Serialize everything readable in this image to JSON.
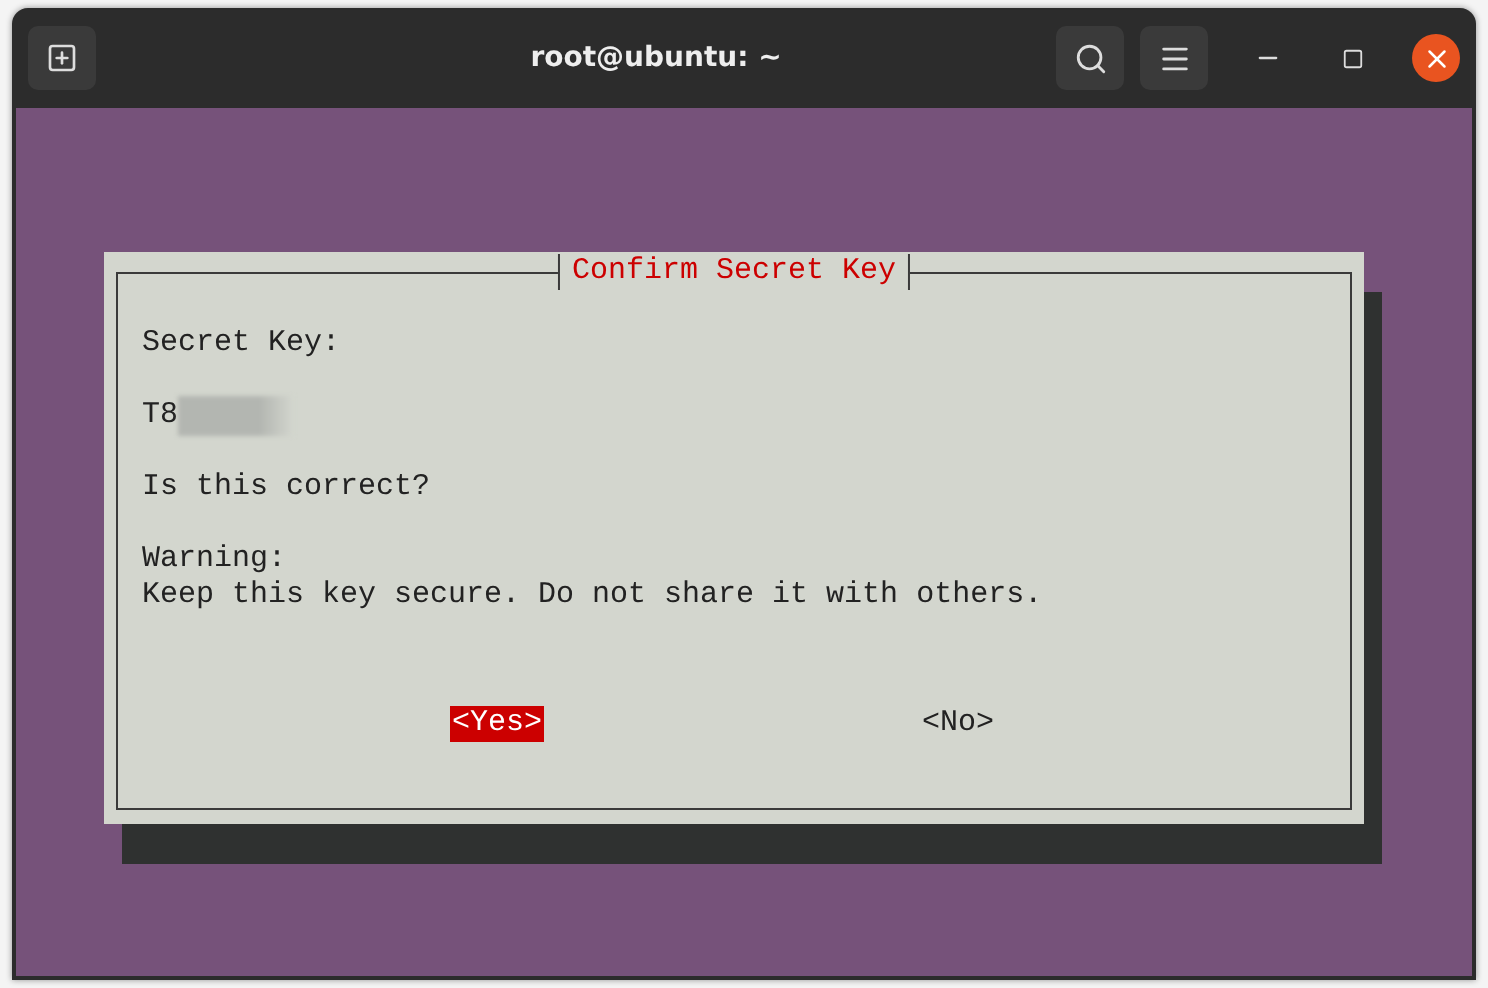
{
  "window": {
    "title": "root@ubuntu: ~"
  },
  "dialog": {
    "title": "Confirm Secret Key",
    "label": "Secret Key:",
    "secret_key": {
      "value": "T8",
      "redacted": true
    },
    "question": "Is this correct?",
    "warning_heading": "Warning:",
    "warning_text": "Keep this key secure. Do not share it with others.",
    "buttons": [
      {
        "label": "<Yes>",
        "selected": true
      },
      {
        "label": "<No>",
        "selected": false
      }
    ]
  }
}
